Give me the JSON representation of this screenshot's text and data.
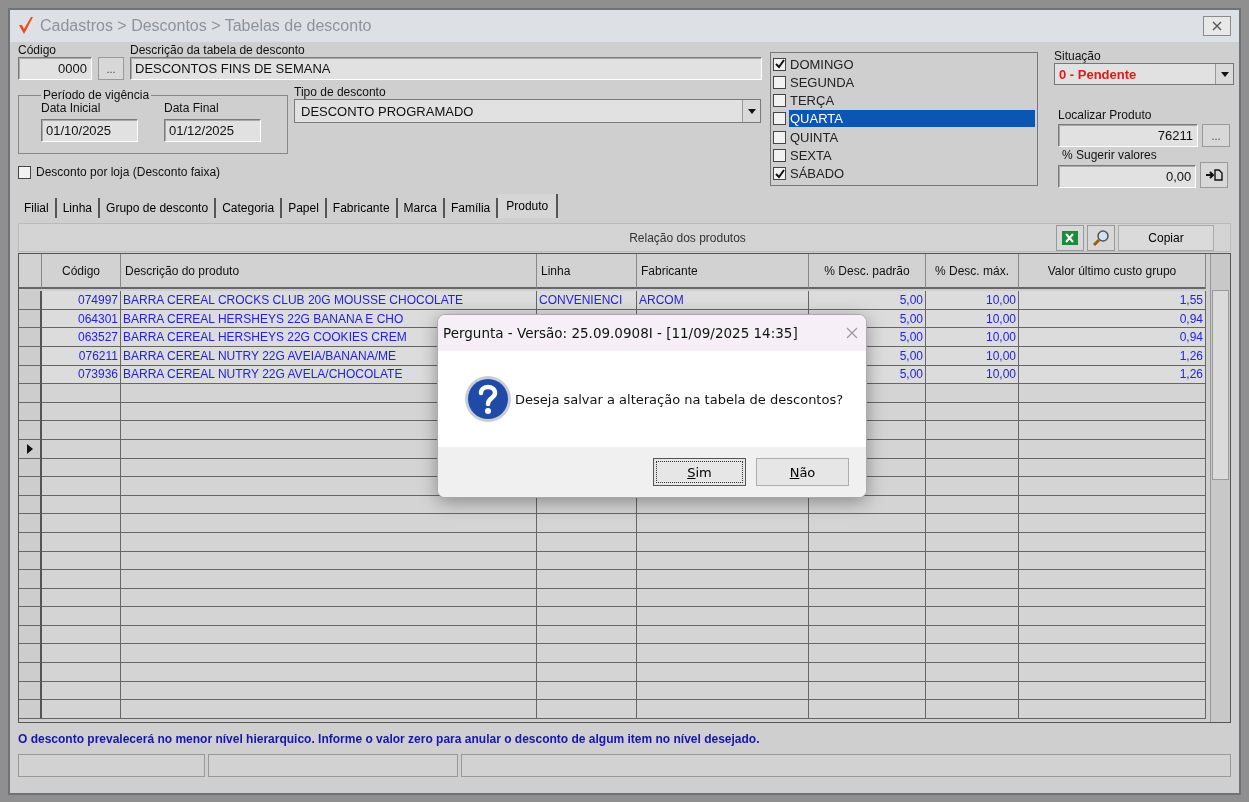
{
  "window": {
    "title": "Cadastros > Descontos > Tabelas de desconto"
  },
  "form": {
    "codigo_label": "Código",
    "codigo": "0000",
    "lookup_button": "...",
    "descricao_label": "Descrição da tabela de desconto",
    "descricao": "DESCONTOS FINS DE SEMANA",
    "periodo_label": "Período de vigência",
    "data_inicial_label": "Data Inicial",
    "data_inicial": "01/10/2025",
    "data_final_label": "Data Final",
    "data_final": "01/12/2025",
    "tipo_label": "Tipo de desconto",
    "tipo": "DESCONTO PROGRAMADO",
    "por_loja": {
      "label": "Desconto por loja (Desconto faixa)",
      "checked": false
    }
  },
  "days": [
    {
      "label": "DOMINGO",
      "checked": true,
      "selected": false
    },
    {
      "label": "SEGUNDA",
      "checked": false,
      "selected": false
    },
    {
      "label": "TERÇA",
      "checked": false,
      "selected": false
    },
    {
      "label": "QUARTA",
      "checked": false,
      "selected": true
    },
    {
      "label": "QUINTA",
      "checked": false,
      "selected": false
    },
    {
      "label": "SEXTA",
      "checked": false,
      "selected": false
    },
    {
      "label": "SÁBADO",
      "checked": true,
      "selected": false
    }
  ],
  "side": {
    "situacao_label": "Situação",
    "situacao": "0 - Pendente",
    "localizar_label": "Localizar Produto",
    "localizar": "76211",
    "localizar_button": "...",
    "sugerir_label": "% Sugerir valores",
    "sugerir": "0,00"
  },
  "tabs": [
    {
      "label": "Filial",
      "selected": false
    },
    {
      "label": "Linha",
      "selected": false
    },
    {
      "label": "Grupo de desconto",
      "selected": false
    },
    {
      "label": "Categoria",
      "selected": false
    },
    {
      "label": "Papel",
      "selected": false
    },
    {
      "label": "Fabricante",
      "selected": false
    },
    {
      "label": "Marca",
      "selected": false
    },
    {
      "label": "Família",
      "selected": false
    },
    {
      "label": "Produto",
      "selected": true
    }
  ],
  "toolbar": {
    "title": "Relação dos produtos",
    "copy_button": "Copiar"
  },
  "table": {
    "columns": [
      "Código",
      "Descrição do produto",
      "Linha",
      "Fabricante",
      "% Desc. padrão",
      "% Desc. máx.",
      "Valor último custo grupo"
    ],
    "rows": [
      [
        "074997",
        "BARRA CEREAL CROCKS CLUB 20G MOUSSE CHOCOLATE",
        "CONVENIENCI",
        "ARCOM",
        "5,00",
        "10,00",
        "1,55"
      ],
      [
        "064301",
        "BARRA CEREAL HERSHEYS 22G BANANA E CHO",
        "",
        "",
        "5,00",
        "10,00",
        "0,94"
      ],
      [
        "063527",
        "BARRA CEREAL HERSHEYS 22G COOKIES CREM",
        "",
        "",
        "5,00",
        "10,00",
        "0,94"
      ],
      [
        "076211",
        "BARRA CEREAL NUTRY 22G AVEIA/BANANA/ME",
        "",
        "",
        "5,00",
        "10,00",
        "1,26"
      ],
      [
        "073936",
        "BARRA CEREAL NUTRY 22G AVELA/CHOCOLATE",
        "",
        "",
        "5,00",
        "10,00",
        "1,26"
      ]
    ]
  },
  "hint": "O desconto prevalecerá no menor nível hierarquico. Informe o valor zero para anular o desconto de algum item no nível desejado.",
  "dialog": {
    "title": "Pergunta - Versão: 25.09.0908I - [11/09/2025 14:35]",
    "message": "Deseja salvar a alteração na tabela de descontos?",
    "buttons": [
      {
        "label": "Sim",
        "focused": true
      },
      {
        "label": "Não",
        "focused": false
      }
    ]
  }
}
